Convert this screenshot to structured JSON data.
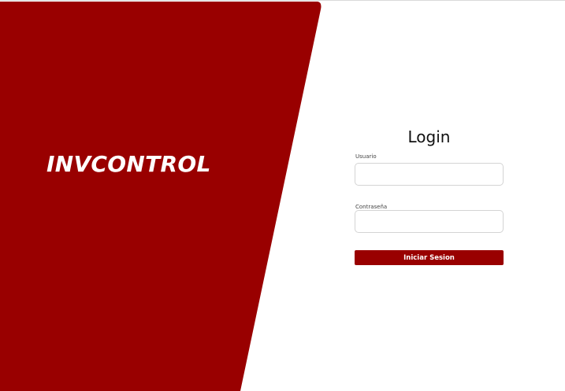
{
  "colors": {
    "brand": "#990000",
    "background": "#ffffff",
    "input_border": "#d4d4d4"
  },
  "brand": {
    "name": "INVCONTROL"
  },
  "login": {
    "title": "Login",
    "username": {
      "label": "Usuario",
      "value": "",
      "placeholder": ""
    },
    "password": {
      "label": "Contraseña",
      "value": "",
      "placeholder": ""
    },
    "submit_label": "Iniciar Sesion"
  }
}
